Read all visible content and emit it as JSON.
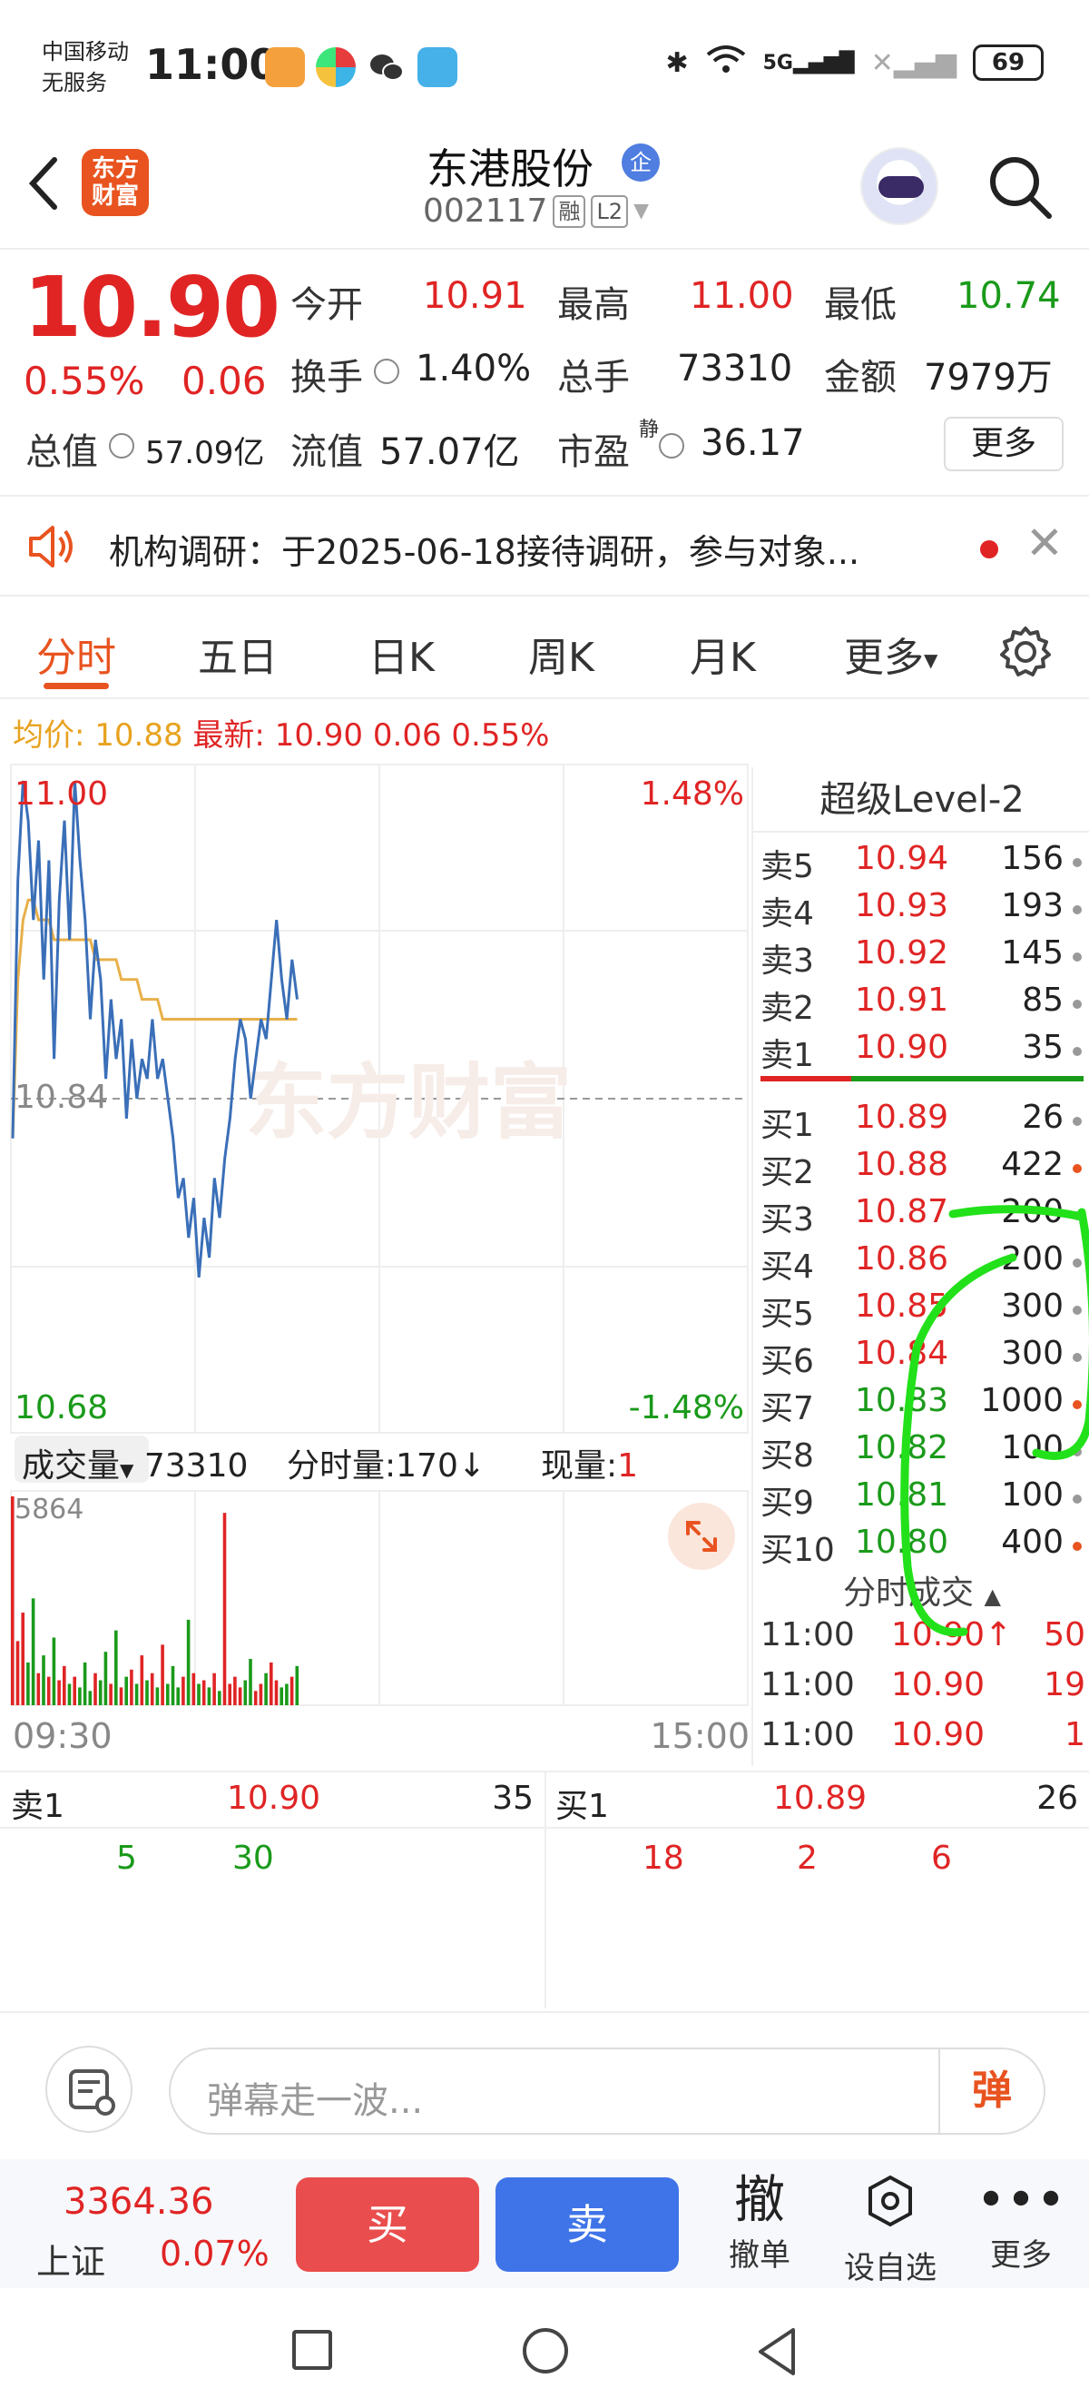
{
  "status": {
    "carrier_line1": "中国移动",
    "carrier_line2": "无服务",
    "time": "11:00",
    "network": "5G",
    "battery": "69"
  },
  "header": {
    "brand": "东方财富",
    "stock_name": "东港股份",
    "badge": "企",
    "code": "002117",
    "tag_margin": "融",
    "tag_level": "L2"
  },
  "quote": {
    "price": "10.90",
    "change_pct": "0.55%",
    "change_val": "0.06",
    "open_label": "今开",
    "open": "10.91",
    "high_label": "最高",
    "high": "11.00",
    "low_label": "最低",
    "low": "10.74",
    "turnover_label": "换手",
    "turnover": "1.40%",
    "volume_label": "总手",
    "volume": "73310",
    "amount_label": "金额",
    "amount": "7979万",
    "mktcap_label": "总值",
    "mktcap": "57.09亿",
    "float_label": "流值",
    "float": "57.07亿",
    "pe_label": "市盈",
    "pe_sup": "静",
    "pe": "36.17",
    "more": "更多"
  },
  "notice": {
    "text": "机构调研：于2025-06-18接待调研，参与对象..."
  },
  "tabs": [
    "分时",
    "五日",
    "日K",
    "周K",
    "月K",
    "更多"
  ],
  "avg_line": {
    "avg_label": "均价:",
    "avg": "10.88",
    "latest_label": "最新:",
    "latest": "10.90",
    "chg": "0.06",
    "pct": "0.55%"
  },
  "chart_data": {
    "type": "line",
    "y_top": "11.00",
    "y_mid": "10.84",
    "y_bottom": "10.68",
    "pct_top": "1.48%",
    "pct_bottom": "-1.48%",
    "x_start": "09:30",
    "x_end": "15:00",
    "ylim": [
      10.68,
      11.0
    ],
    "price": [
      10.82,
      10.95,
      11.0,
      10.98,
      10.93,
      10.97,
      10.9,
      10.96,
      10.86,
      10.94,
      10.98,
      10.92,
      11.0,
      10.96,
      10.93,
      10.88,
      10.92,
      10.9,
      10.85,
      10.89,
      10.86,
      10.88,
      10.83,
      10.87,
      10.84,
      10.86,
      10.85,
      10.88,
      10.85,
      10.86,
      10.84,
      10.82,
      10.79,
      10.8,
      10.77,
      10.79,
      10.75,
      10.78,
      10.76,
      10.8,
      10.78,
      10.81,
      10.83,
      10.86,
      10.88,
      10.87,
      10.84,
      10.86,
      10.88,
      10.87,
      10.9,
      10.93,
      10.9,
      10.88,
      10.91,
      10.89
    ],
    "avg": [
      10.82,
      10.9,
      10.93,
      10.94,
      10.94,
      10.93,
      10.93,
      10.93,
      10.92,
      10.92,
      10.92,
      10.92,
      10.92,
      10.92,
      10.92,
      10.92,
      10.91,
      10.91,
      10.91,
      10.91,
      10.91,
      10.9,
      10.9,
      10.9,
      10.9,
      10.89,
      10.89,
      10.89,
      10.89,
      10.88,
      10.88,
      10.88,
      10.88,
      10.88,
      10.88,
      10.88,
      10.88,
      10.88,
      10.88,
      10.88,
      10.88,
      10.88,
      10.88,
      10.88,
      10.88,
      10.88,
      10.88,
      10.88,
      10.88,
      10.88,
      10.88,
      10.88,
      10.88,
      10.88,
      10.88,
      10.88
    ],
    "volume_max": "5864",
    "volume": [
      5864,
      1800,
      2600,
      1200,
      3000,
      900,
      1400,
      800,
      1900,
      700,
      1100,
      600,
      800,
      500,
      1200,
      400,
      900,
      700,
      1500,
      600,
      2100,
      500,
      800,
      1000,
      600,
      1400,
      700,
      900,
      500,
      1700,
      600,
      1100,
      500,
      800,
      2400,
      900,
      600,
      700,
      500,
      900,
      400,
      5400,
      600,
      800,
      500,
      700,
      1300,
      400,
      600,
      900,
      1200,
      700,
      500,
      600,
      800,
      1100
    ]
  },
  "volume_bar": {
    "label": "成交量",
    "total": "73310",
    "minute_label": "分时量:170",
    "now_label": "现量:",
    "now": "1"
  },
  "level2": {
    "title": "超级Level-2",
    "asks": [
      {
        "label": "卖5",
        "price": "10.94",
        "qty": "156"
      },
      {
        "label": "卖4",
        "price": "10.93",
        "qty": "193"
      },
      {
        "label": "卖3",
        "price": "10.92",
        "qty": "145"
      },
      {
        "label": "卖2",
        "price": "10.91",
        "qty": "85"
      },
      {
        "label": "卖1",
        "price": "10.90",
        "qty": "35"
      }
    ],
    "bids": [
      {
        "label": "买1",
        "price": "10.89",
        "qty": "26"
      },
      {
        "label": "买2",
        "price": "10.88",
        "qty": "422"
      },
      {
        "label": "买3",
        "price": "10.87",
        "qty": "200"
      },
      {
        "label": "买4",
        "price": "10.86",
        "qty": "200"
      },
      {
        "label": "买5",
        "price": "10.85",
        "qty": "300"
      },
      {
        "label": "买6",
        "price": "10.84",
        "qty": "300"
      },
      {
        "label": "买7",
        "price": "10.83",
        "qty": "1000"
      },
      {
        "label": "买8",
        "price": "10.82",
        "qty": "100"
      },
      {
        "label": "买9",
        "price": "10.81",
        "qty": "100"
      },
      {
        "label": "买10",
        "price": "10.80",
        "qty": "400"
      }
    ],
    "ticks_title": "分时成交",
    "ticks": [
      {
        "time": "11:00",
        "price": "10.90↑",
        "qty": "50"
      },
      {
        "time": "11:00",
        "price": "10.90",
        "qty": "19"
      },
      {
        "time": "11:00",
        "price": "10.90",
        "qty": "1"
      }
    ]
  },
  "strip": {
    "sell_label": "卖1",
    "sell_price": "10.90",
    "sell_qty": "35",
    "buy_label": "买1",
    "buy_price": "10.89",
    "buy_qty": "26",
    "sell_orders": [
      "5",
      "30"
    ],
    "buy_orders": [
      "18",
      "2",
      "6"
    ]
  },
  "comment": {
    "placeholder": "弹幕走一波...",
    "btn": "弹"
  },
  "trade": {
    "index_value": "3364.36",
    "index_name": "上证",
    "index_pct": "0.07%",
    "buy": "买",
    "sell": "卖",
    "cancel_icon": "撤",
    "cancel": "撤单",
    "watch": "设自选",
    "more": "更多"
  }
}
